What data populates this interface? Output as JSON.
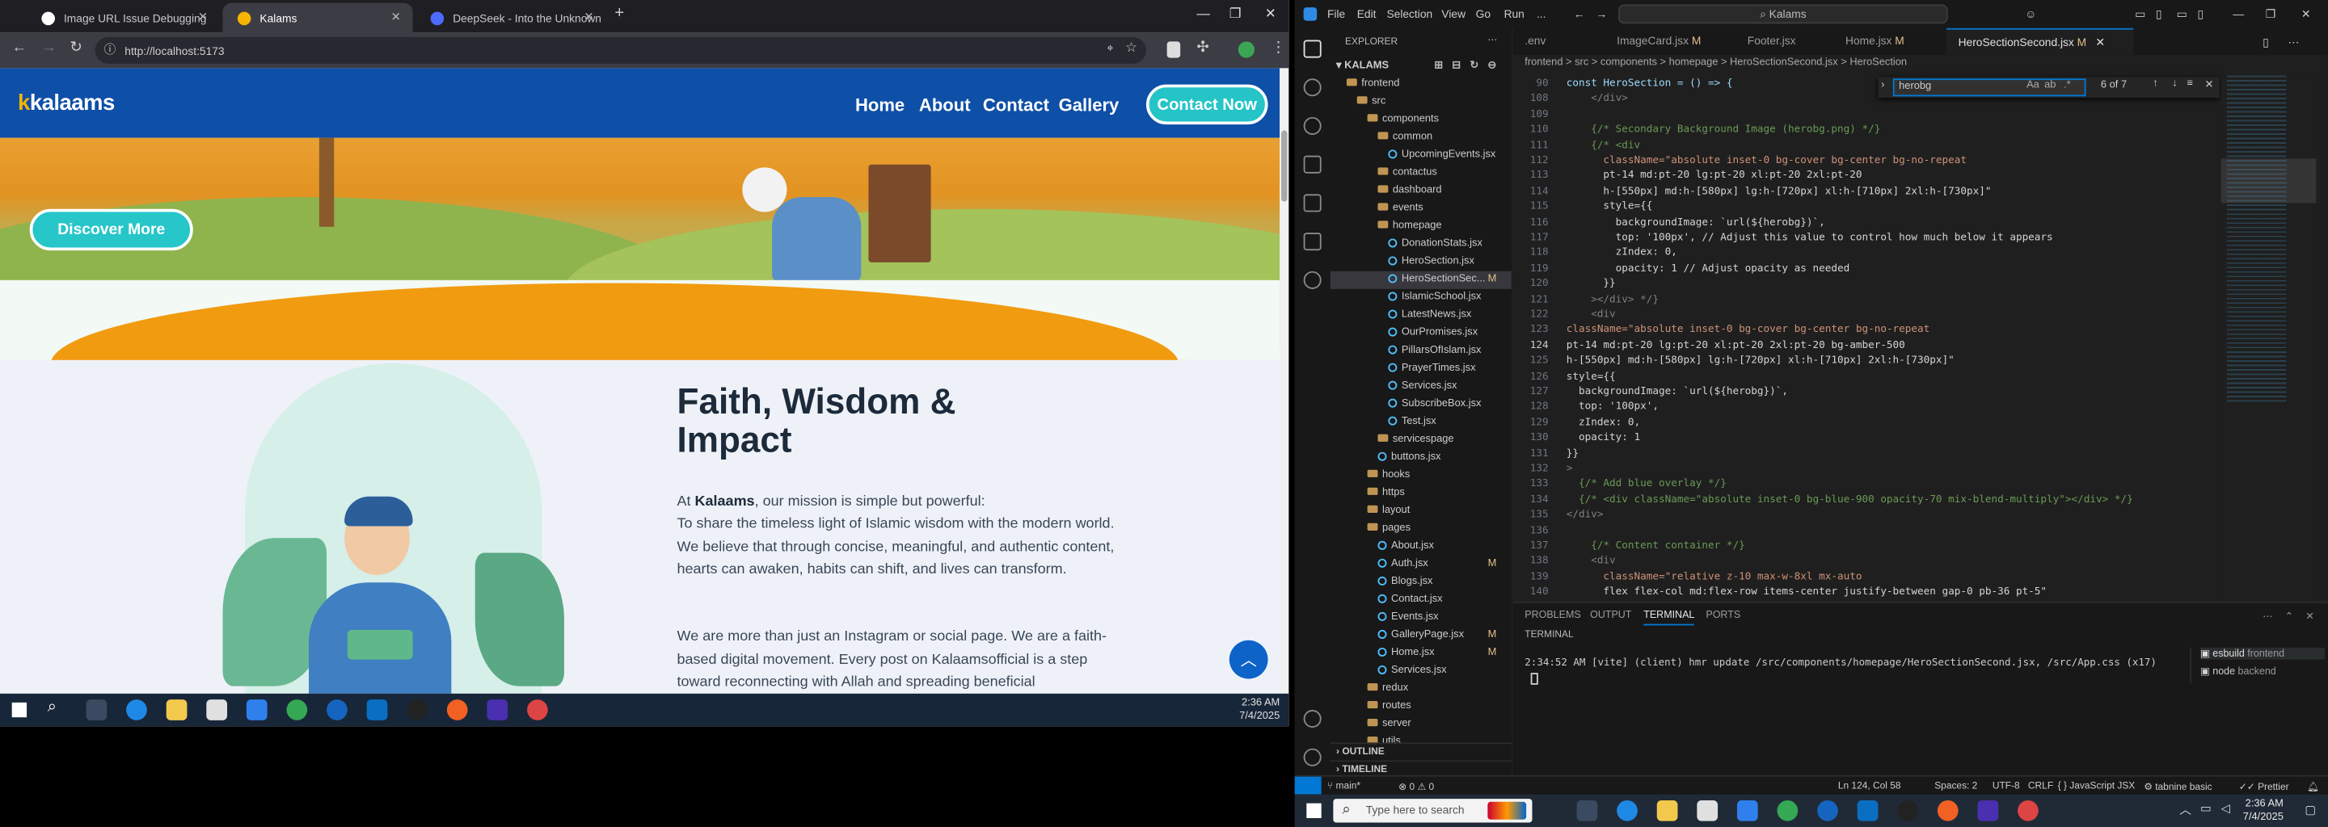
{
  "browser": {
    "tabs": [
      {
        "title": "Image URL Issue Debugging",
        "color": "#ffffff"
      },
      {
        "title": "Kalams",
        "color": "#f6b400"
      },
      {
        "title": "DeepSeek - Into the Unknown",
        "color": "#4d6bfe"
      }
    ],
    "url": "http://localhost:5173"
  },
  "site": {
    "logo_prefix": "k",
    "logo_text": "kalaams",
    "nav": [
      "Home",
      "About",
      "Contact",
      "Gallery"
    ],
    "contact_button": "Contact Now",
    "discover_button": "Discover More",
    "heading_line1": "Faith, Wisdom &",
    "heading_line2": "Impact",
    "p1_prefix": "At ",
    "p1_brand": "Kalaams",
    "p1_suffix": ", our mission is simple but powerful:",
    "p2": "To share the timeless light of Islamic wisdom with the modern world. We believe that through concise, meaningful, and authentic content, hearts can awaken, habits can shift, and lives can transform.",
    "p3": "We are more than just an Instagram or social page. We are a faith-based digital movement. Every post on Kalaamsofficial is a step toward reconnecting with Allah and spreading beneficial"
  },
  "left_taskbar": {
    "time": "2:36 AM",
    "date": "7/4/2025"
  },
  "vscode": {
    "menu": [
      "File",
      "Edit",
      "Selection",
      "View",
      "Go",
      "Run",
      "..."
    ],
    "search": "Kalams",
    "explorer_title": "EXPLORER",
    "root": "KALAMS",
    "tree": [
      {
        "label": "frontend",
        "depth": 1,
        "type": "folder"
      },
      {
        "label": "src",
        "depth": 2,
        "type": "folder"
      },
      {
        "label": "components",
        "depth": 3,
        "type": "folder"
      },
      {
        "label": "common",
        "depth": 4,
        "type": "folder"
      },
      {
        "label": "UpcomingEvents.jsx",
        "depth": 5,
        "type": "file"
      },
      {
        "label": "contactus",
        "depth": 4,
        "type": "folder"
      },
      {
        "label": "dashboard",
        "depth": 4,
        "type": "folder"
      },
      {
        "label": "events",
        "depth": 4,
        "type": "folder"
      },
      {
        "label": "homepage",
        "depth": 4,
        "type": "folder"
      },
      {
        "label": "DonationStats.jsx",
        "depth": 5,
        "type": "file"
      },
      {
        "label": "HeroSection.jsx",
        "depth": 5,
        "type": "file"
      },
      {
        "label": "HeroSectionSec...",
        "depth": 5,
        "type": "file",
        "badge": "M",
        "selected": true
      },
      {
        "label": "IslamicSchool.jsx",
        "depth": 5,
        "type": "file"
      },
      {
        "label": "LatestNews.jsx",
        "depth": 5,
        "type": "file"
      },
      {
        "label": "OurPromises.jsx",
        "depth": 5,
        "type": "file"
      },
      {
        "label": "PillarsOfIslam.jsx",
        "depth": 5,
        "type": "file"
      },
      {
        "label": "PrayerTimes.jsx",
        "depth": 5,
        "type": "file"
      },
      {
        "label": "Services.jsx",
        "depth": 5,
        "type": "file"
      },
      {
        "label": "SubscribeBox.jsx",
        "depth": 5,
        "type": "file"
      },
      {
        "label": "Test.jsx",
        "depth": 5,
        "type": "file"
      },
      {
        "label": "servicespage",
        "depth": 4,
        "type": "folder"
      },
      {
        "label": "buttons.jsx",
        "depth": 4,
        "type": "file"
      },
      {
        "label": "hooks",
        "depth": 3,
        "type": "folder"
      },
      {
        "label": "https",
        "depth": 3,
        "type": "folder"
      },
      {
        "label": "layout",
        "depth": 3,
        "type": "folder"
      },
      {
        "label": "pages",
        "depth": 3,
        "type": "folder"
      },
      {
        "label": "About.jsx",
        "depth": 4,
        "type": "file"
      },
      {
        "label": "Auth.jsx",
        "depth": 4,
        "type": "file",
        "badge": "M"
      },
      {
        "label": "Blogs.jsx",
        "depth": 4,
        "type": "file"
      },
      {
        "label": "Contact.jsx",
        "depth": 4,
        "type": "file"
      },
      {
        "label": "Events.jsx",
        "depth": 4,
        "type": "file"
      },
      {
        "label": "GalleryPage.jsx",
        "depth": 4,
        "type": "file",
        "badge": "M"
      },
      {
        "label": "Home.jsx",
        "depth": 4,
        "type": "file",
        "badge": "M"
      },
      {
        "label": "Services.jsx",
        "depth": 4,
        "type": "file"
      },
      {
        "label": "redux",
        "depth": 3,
        "type": "folder"
      },
      {
        "label": "routes",
        "depth": 3,
        "type": "folder"
      },
      {
        "label": "server",
        "depth": 3,
        "type": "folder"
      },
      {
        "label": "utils",
        "depth": 3,
        "type": "folder"
      }
    ],
    "outline": "OUTLINE",
    "timeline": "TIMELINE",
    "tabs": [
      {
        "label": ".env",
        "badge": ""
      },
      {
        "label": "ImageCard.jsx",
        "badge": "M"
      },
      {
        "label": "Footer.jsx",
        "badge": ""
      },
      {
        "label": "Home.jsx",
        "badge": "M"
      },
      {
        "label": "HeroSectionSecond.jsx",
        "badge": "M"
      }
    ],
    "breadcrumb": "frontend > src > components > homepage > HeroSectionSecond.jsx > HeroSection",
    "find_query": "herobg",
    "find_count": "6 of 7",
    "code_lines": [
      {
        "n": "90",
        "t": "const HeroSection = () => {"
      },
      {
        "n": "108",
        "t": "    </div>"
      },
      {
        "n": "109",
        "t": ""
      },
      {
        "n": "110",
        "t": "    {/* Secondary Background Image (herobg.png) */}"
      },
      {
        "n": "111",
        "t": "    {/* <div"
      },
      {
        "n": "112",
        "t": "      className=\"absolute inset-0 bg-cover bg-center bg-no-repeat"
      },
      {
        "n": "113",
        "t": "      pt-14 md:pt-20 lg:pt-20 xl:pt-20 2xl:pt-20"
      },
      {
        "n": "114",
        "t": "      h-[550px] md:h-[580px] lg:h-[720px] xl:h-[710px] 2xl:h-[730px]\""
      },
      {
        "n": "115",
        "t": "      style={{"
      },
      {
        "n": "116",
        "t": "        backgroundImage: `url(${herobg})`,"
      },
      {
        "n": "117",
        "t": "        top: '100px', // Adjust this value to control how much below it appears"
      },
      {
        "n": "118",
        "t": "        zIndex: 0,"
      },
      {
        "n": "119",
        "t": "        opacity: 1 // Adjust opacity as needed"
      },
      {
        "n": "120",
        "t": "      }}"
      },
      {
        "n": "121",
        "t": "    ></div> */}"
      },
      {
        "n": "122",
        "t": "    <div"
      },
      {
        "n": "123",
        "t": "className=\"absolute inset-0 bg-cover bg-center bg-no-repeat"
      },
      {
        "n": "124",
        "t": "pt-14 md:pt-20 lg:pt-20 xl:pt-20 2xl:pt-20 bg-amber-500"
      },
      {
        "n": "125",
        "t": "h-[550px] md:h-[580px] lg:h-[720px] xl:h-[710px] 2xl:h-[730px]\""
      },
      {
        "n": "126",
        "t": "style={{"
      },
      {
        "n": "127",
        "t": "  backgroundImage: `url(${herobg})`,"
      },
      {
        "n": "128",
        "t": "  top: '100px',"
      },
      {
        "n": "129",
        "t": "  zIndex: 0,"
      },
      {
        "n": "130",
        "t": "  opacity: 1"
      },
      {
        "n": "131",
        "t": "}}"
      },
      {
        "n": "132",
        "t": ">"
      },
      {
        "n": "133",
        "t": "  {/* Add blue overlay */}"
      },
      {
        "n": "134",
        "t": "  {/* <div className=\"absolute inset-0 bg-blue-900 opacity-70 mix-blend-multiply\"></div> */}"
      },
      {
        "n": "135",
        "t": "</div>"
      },
      {
        "n": "136",
        "t": ""
      },
      {
        "n": "137",
        "t": "    {/* Content container */}"
      },
      {
        "n": "138",
        "t": "    <div"
      },
      {
        "n": "139",
        "t": "      className=\"relative z-10 max-w-8xl mx-auto"
      },
      {
        "n": "140",
        "t": "      flex flex-col md:flex-row items-center justify-between gap-0 pb-36 pt-5\""
      }
    ],
    "panel_tabs": [
      "PROBLEMS",
      "OUTPUT",
      "TERMINAL",
      "PORTS"
    ],
    "terminal_title": "TERMINAL",
    "terminal_line": "2:34:52 AM [vite] (client) hmr update /src/components/homepage/HeroSectionSecond.jsx, /src/App.css (x17)",
    "terminals": [
      {
        "name": "esbuild",
        "folder": "frontend"
      },
      {
        "name": "node",
        "folder": "backend"
      }
    ],
    "status": {
      "branch": "main*",
      "problems": "0 ⚠ 0",
      "position": "Ln 124, Col 58",
      "spaces": "Spaces: 2",
      "encoding": "UTF-8",
      "eol": "CRLF",
      "language": "JavaScript JSX",
      "tabnine": "tabnine basic",
      "prettier": "Prettier"
    }
  },
  "right_taskbar": {
    "search_placeholder": "Type here to search",
    "time": "2:36 AM",
    "date": "7/4/2025"
  }
}
